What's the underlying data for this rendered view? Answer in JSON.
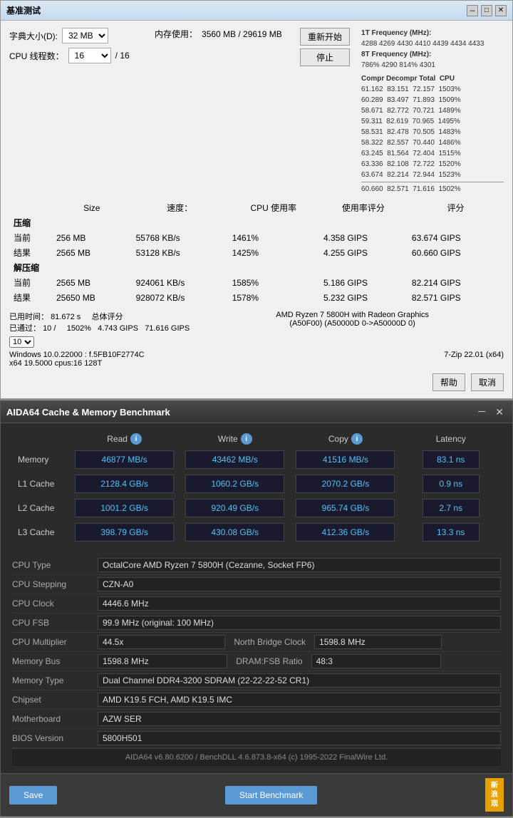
{
  "top_window": {
    "title": "基准测试",
    "fields": {
      "dict_size_label": "字典大小(D):",
      "dict_size_value": "32 MB",
      "memory_usage_label": "内存使用：",
      "memory_usage_value": "3560 MB / 29619 MB",
      "cpu_threads_label": "CPU 线程数：",
      "cpu_threads_value": "16",
      "cpu_threads_max": "/ 16"
    },
    "buttons": {
      "restart": "重新开始",
      "stop": "停止"
    },
    "table": {
      "headers": [
        "",
        "Size",
        "速度：",
        "CPU 使用率",
        "使用率评分",
        "评分"
      ],
      "compression_label": "压缩",
      "rows_comp": [
        [
          "当前",
          "256 MB",
          "55768 KB/s",
          "1461%",
          "4.358 GIPS",
          "63.674 GIPS"
        ],
        [
          "结果",
          "2565 MB",
          "53128 KB/s",
          "1425%",
          "4.255 GIPS",
          "60.660 GIPS"
        ]
      ],
      "decompression_label": "解压缩",
      "rows_decomp": [
        [
          "当前",
          "2565 MB",
          "924061 KB/s",
          "1585%",
          "5.186 GIPS",
          "82.214 GIPS"
        ],
        [
          "结果",
          "25650 MB",
          "928072 KB/s",
          "1578%",
          "5.232 GIPS",
          "82.571 GIPS"
        ]
      ]
    },
    "bottom": {
      "elapsed_label": "已用时间：",
      "elapsed_value": "81.672 s",
      "total_score_label": "总体评分",
      "passed_label": "已通过：",
      "passed_value": "10 /",
      "score_value": "1502%",
      "gips_value": "4.743 GIPS",
      "total_gips": "71.616 GIPS",
      "cpu_info": "AMD Ryzen 7 5800H with Radeon Graphics\n(A50F00) (A50000D 0->A50000D 0)",
      "os_info": "Windows 10.0.22000 : f.5FB10F2774C",
      "zip_info": "7-Zip 22.01 (x64)",
      "cpu_detail": "x64 19.5000 cpus:16 128T"
    },
    "footer_buttons": {
      "help": "帮助",
      "cancel": "取消"
    }
  },
  "aida_window": {
    "title": "AIDA64 Cache & Memory Benchmark",
    "columns": {
      "read": "Read",
      "write": "Write",
      "copy": "Copy",
      "latency": "Latency"
    },
    "rows": [
      {
        "label": "Memory",
        "read": "46877 MB/s",
        "write": "43462 MB/s",
        "copy": "41516 MB/s",
        "latency": "83.1 ns"
      },
      {
        "label": "L1 Cache",
        "read": "2128.4 GB/s",
        "write": "1060.2 GB/s",
        "copy": "2070.2 GB/s",
        "latency": "0.9 ns"
      },
      {
        "label": "L2 Cache",
        "read": "1001.2 GB/s",
        "write": "920.49 GB/s",
        "copy": "965.74 GB/s",
        "latency": "2.7 ns"
      },
      {
        "label": "L3 Cache",
        "read": "398.79 GB/s",
        "write": "430.08 GB/s",
        "copy": "412.36 GB/s",
        "latency": "13.3 ns"
      }
    ],
    "sysinfo": [
      {
        "label": "CPU Type",
        "value": "OctalCore AMD Ryzen 7 5800H  (Cezanne, Socket FP6)",
        "full_row": true
      },
      {
        "label": "CPU Stepping",
        "value": "CZN-A0",
        "full_row": true
      },
      {
        "label": "CPU Clock",
        "value": "4446.6 MHz",
        "full_row": true
      },
      {
        "label": "CPU FSB",
        "value": "99.9 MHz  (original: 100 MHz)",
        "full_row": true
      },
      {
        "label": "CPU Multiplier",
        "value": "44.5x",
        "extra_label": "North Bridge Clock",
        "extra_value": "1598.8 MHz",
        "split": true
      },
      {
        "label": "Memory Bus",
        "value": "1598.8 MHz",
        "extra_label": "DRAM:FSB Ratio",
        "extra_value": "48:3",
        "split": true
      },
      {
        "label": "Memory Type",
        "value": "Dual Channel DDR4-3200 SDRAM  (22-22-22-52 CR1)",
        "full_row": true
      },
      {
        "label": "Chipset",
        "value": "AMD K19.5 FCH, AMD K19.5 IMC",
        "full_row": true
      },
      {
        "label": "Motherboard",
        "value": "AZW SER",
        "full_row": true
      },
      {
        "label": "BIOS Version",
        "value": "5800H501",
        "full_row": true
      }
    ],
    "footer": "AIDA64 v6.80.6200 / BenchDLL 4.6.873.8-x64  (c) 1995-2022 FinalWire Ltd.",
    "buttons": {
      "save": "Save",
      "start": "Start Benchmark"
    },
    "brand": "新\n浪\n观"
  },
  "right_panel": {
    "freq_title": "1T Frequency (MHz):",
    "freq_values": "4288 4269 4430 4410 4439 4434 4433",
    "freq8t_title": "8T Frequency (MHz):",
    "freq8t_values": "786% 4290 814% 4301",
    "table_header": "Compr Decompr Total  CPU",
    "rows": [
      "61.162  83.151  72.157  1503%",
      "60.289  83.497  71.893  1509%",
      "58.671  82.772  70.721  1489%",
      "59.311  82.619  70.965  1495%",
      "58.531  82.478  70.505  1483%",
      "58.322  82.557  70.440  1486%",
      "63.245  81.564  72.404  1515%",
      "63.336  82.108  72.722  1520%",
      "63.674  82.214  72.944  1523%",
      "separator",
      "60.660  82.571  71.616  1502%"
    ]
  }
}
